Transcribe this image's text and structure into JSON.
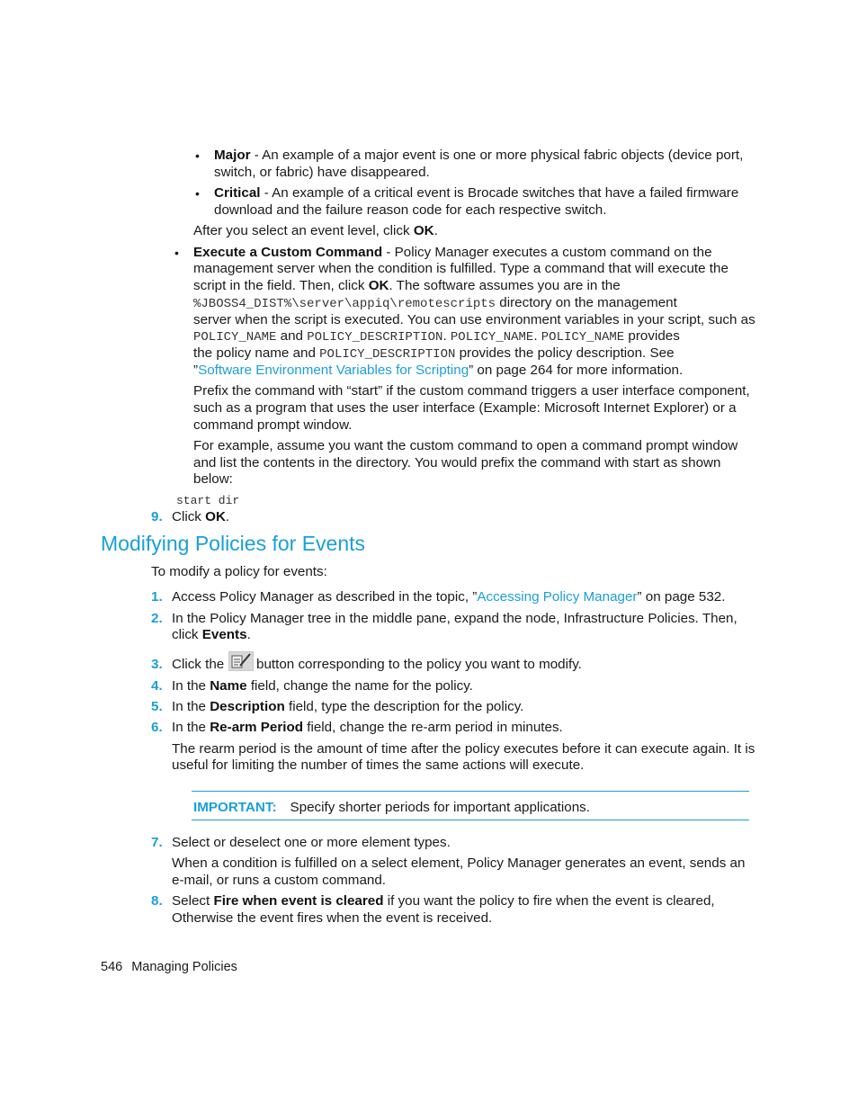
{
  "event_levels": {
    "major": {
      "label": "Major",
      "text_1": " - An example of a major event is one or more physical fabric objects (device port,",
      "text_2": "switch, or fabric) have disappeared."
    },
    "critical": {
      "label": "Critical",
      "text_1": " - An example of a critical event is Brocade switches that have a failed firmware",
      "text_2": "download and the failure reason code for each respective switch."
    },
    "after_select": {
      "pre": "After you select an event level, click ",
      "bold": "OK",
      "post": "."
    }
  },
  "custom_command": {
    "label": "Execute a Custom Command",
    "l1": " - Policy Manager executes a custom command on the",
    "l2": "management server when the condition is fulfilled. Type a command that will execute the",
    "l3_pre": "script in the field. Then, click ",
    "l3_bold": "OK",
    "l3_post": ". The software assumes you are in the",
    "l4_code": "%JBOSS4_DIST%\\server\\appiq\\remotescripts",
    "l4_post": " directory on the management",
    "l5": "server when the script is executed. You can use environment variables in your script, such as",
    "l6_code1": "POLICY_NAME",
    "l6_and": " and ",
    "l6_code2": "POLICY_DESCRIPTION",
    "l6_dot": ". ",
    "l6_code3": "POLICY_NAME",
    "l6_dot2": ". ",
    "l6_code4": "POLICY_NAME",
    "l6_post": "  provides",
    "l7_pre": "the policy name and ",
    "l7_code": "POLICY_DESCRIPTION",
    "l7_post": " provides the policy description. See",
    "l8_quote": "”",
    "l8_link": "Software Environment Variables for Scripting",
    "l8_post": "” on page 264 for more information.",
    "prefix_p": [
      "Prefix the command with “start” if the custom command triggers a user interface component,",
      "such as a program that uses the user interface (Example: Microsoft Internet Explorer) or a",
      "command prompt window."
    ],
    "example_p": [
      "For example, assume you want the custom command to open a command prompt window",
      "and list the contents in the directory. You would prefix the command with start as shown",
      "below:"
    ],
    "code_example": "start dir"
  },
  "step9": {
    "num": "9.",
    "pre": "Click ",
    "bold": "OK",
    "post": "."
  },
  "section": {
    "title": "Modifying Policies for Events",
    "intro": "To modify a policy for events:",
    "steps": [
      {
        "num": "1.",
        "pre": "Access Policy Manager as described in the topic, ”",
        "link": "Accessing Policy Manager",
        "post": "” on page 532."
      },
      {
        "num": "2.",
        "l1": "In the Policy Manager tree in the middle pane, expand the node, Infrastructure Policies. Then,",
        "l2_pre": "click ",
        "l2_bold": "Events",
        "l2_post": "."
      },
      {
        "num": "3.",
        "pre": "Click the ",
        "post": " button corresponding to the policy you want to modify."
      },
      {
        "num": "4.",
        "pre": "In the ",
        "bold": "Name",
        "post": " field, change the name for the policy."
      },
      {
        "num": "5.",
        "pre": "In the ",
        "bold": "Description",
        "post": " field, type the description for the policy."
      },
      {
        "num": "6.",
        "pre": "In the ",
        "bold": "Re-arm Period",
        "post": " field, change the re-arm period in minutes.",
        "note": [
          "The rearm period is the amount of time after the policy executes before it can execute again. It is",
          "useful for limiting the number of times the same actions will execute."
        ]
      },
      {
        "num": "7.",
        "text": "Select or deselect one or more element types.",
        "note": [
          "When a condition is fulfilled on a select element, Policy Manager generates an event, sends an",
          "e-mail, or runs a custom command."
        ]
      },
      {
        "num": "8.",
        "pre": "Select ",
        "bold": "Fire when event is cleared",
        "post": " if you want the policy to fire when the event is cleared,",
        "l2": "Otherwise the event fires when the event is received."
      }
    ],
    "important": {
      "label": "IMPORTANT:",
      "text": "Specify shorter periods for important applications."
    }
  },
  "footer": {
    "page_number": "546",
    "chapter": "Managing Policies"
  },
  "icons": {
    "edit": "edit-policy-icon"
  }
}
